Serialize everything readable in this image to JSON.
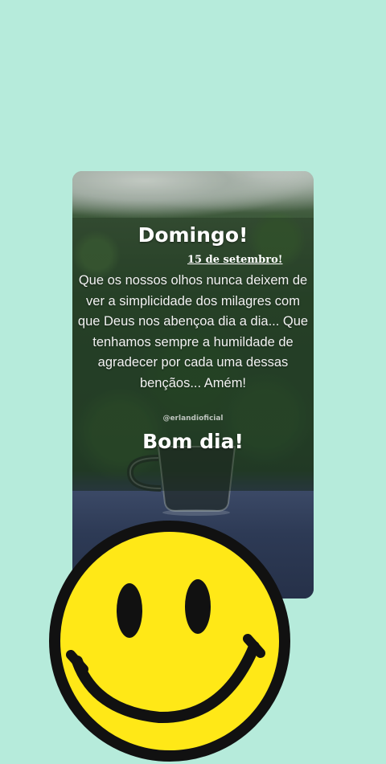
{
  "post": {
    "title": "Domingo!",
    "date": "15 de setembro!",
    "message": "Que os nossos olhos nunca deixem de ver a simplicidade dos milagres com que Deus nos abençoa dia a dia... Que tenhamos sempre a humildade de agradecer por cada uma dessas bençãos... Amém!",
    "handle": "@erlandioficial",
    "greeting": "Bom dia!"
  },
  "sticker": {
    "icon": "smiley-face-icon",
    "face_color": "#ffe817",
    "outline_color": "#111111"
  },
  "colors": {
    "background": "#b6ebdb"
  }
}
